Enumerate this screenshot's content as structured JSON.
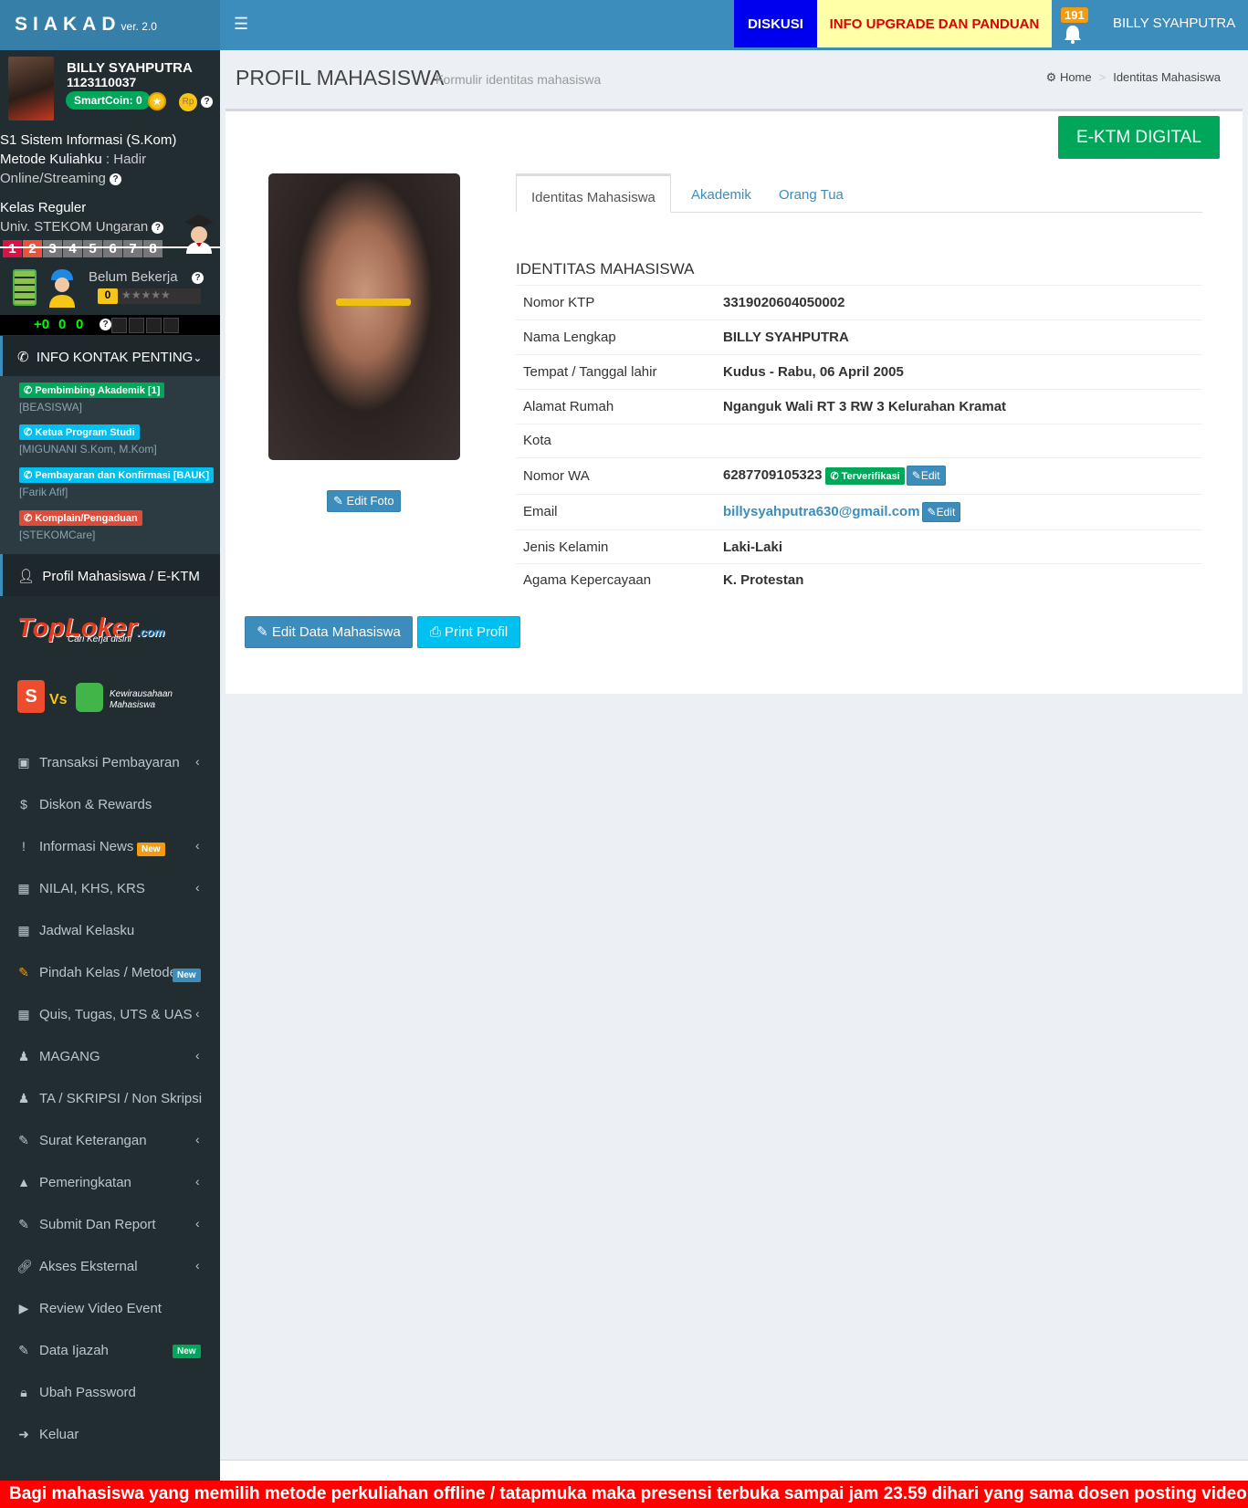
{
  "header": {
    "brand": "SIAKAD",
    "version": "ver. 2.0",
    "diskusi": "DISKUSI",
    "upgrade": "INFO UPGRADE DAN PANDUAN",
    "notif_count": "191",
    "user": "BILLY SYAHPUTRA"
  },
  "sidebar": {
    "name": "BILLY SYAHPUTRA",
    "nim": "1123110037",
    "smartcoin": "SmartCoin: 0",
    "prodi": "S1 Sistem Informasi (S.Kom)",
    "metode_label": "Metode Kuliahku",
    "metode_value": ": Hadir",
    "metode_line2": "Online/Streaming",
    "kelas": "Kelas Reguler",
    "kampus": "Univ. STEKOM Ungaran",
    "semesters": [
      "1",
      "2",
      "3",
      "4",
      "5",
      "6",
      "7",
      "8"
    ],
    "status": "Belum Bekerja",
    "stars": "★★★★★",
    "counter_plus": "+0",
    "counter_a": "0",
    "counter_b": "0",
    "info_kontak": "INFO KONTAK PENTING",
    "contacts": [
      {
        "label": "Pembimbing Akademik [1]",
        "sub": "[BEASISWA]"
      },
      {
        "label": "Ketua Program Studi",
        "sub": "[MIGUNANI S.Kom, M.Kom]"
      },
      {
        "label": "Pembayaran dan Konfirmasi [BAUK]",
        "sub": "[Farik Afif]"
      },
      {
        "label": "Komplain/Pengaduan",
        "sub": "[STEKOMCare]"
      }
    ],
    "profil_menu": "Profil Mahasiswa / E-KTM",
    "toploker": "TopLoker",
    "toploker_com": ".com",
    "toploker_sub": "Cari Kerja disini",
    "vs": "Vs",
    "kewirausahaan": "Kewirausahaan Mahasiswa",
    "menu": [
      {
        "label": "Transaksi Pembayaran"
      },
      {
        "label": "Diskon & Rewards"
      },
      {
        "label": "Informasi News",
        "badge": "New"
      },
      {
        "label": "NILAI, KHS, KRS"
      },
      {
        "label": "Jadwal Kelasku"
      },
      {
        "label": "Pindah Kelas / Metode",
        "badge": "New"
      },
      {
        "label": "Quis, Tugas, UTS & UAS"
      },
      {
        "label": "MAGANG"
      },
      {
        "label": "TA / SKRIPSI / Non Skripsi"
      },
      {
        "label": "Surat Keterangan"
      },
      {
        "label": "Pemeringkatan"
      },
      {
        "label": "Submit Dan Report"
      },
      {
        "label": "Akses Eksternal"
      },
      {
        "label": "Review Video Event"
      },
      {
        "label": "Data Ijazah",
        "badge": "New"
      },
      {
        "label": "Ubah Password"
      },
      {
        "label": "Keluar"
      }
    ]
  },
  "page": {
    "title": "PROFIL MAHASISWA",
    "subtitle": "Formulir identitas mahasiswa",
    "breadcrumb_home": "Home",
    "breadcrumb_current": "Identitas Mahasiswa",
    "ektm_button": "E-KTM DIGITAL",
    "edit_foto": "Edit Foto",
    "tabs": [
      "Identitas Mahasiswa",
      "Akademik",
      "Orang Tua"
    ],
    "section_title": "IDENTITAS MAHASISWA",
    "fields": [
      {
        "label": "Nomor KTP",
        "value": "3319020604050002"
      },
      {
        "label": "Nama Lengkap",
        "value": "BILLY SYAHPUTRA"
      },
      {
        "label": "Tempat / Tanggal lahir",
        "value": "Kudus - Rabu, 06 April 2005"
      },
      {
        "label": "Alamat Rumah",
        "value": "Nganguk Wali RT 3 RW 3 Kelurahan Kramat"
      },
      {
        "label": "Kota",
        "value": ""
      },
      {
        "label": "Nomor WA",
        "value": "6287709105323"
      },
      {
        "label": "Email",
        "value": "billysyahputra630@gmail.com"
      },
      {
        "label": "Jenis Kelamin",
        "value": "Laki-Laki"
      },
      {
        "label": "Agama Kepercayaan",
        "value": "K. Protestan"
      }
    ],
    "verified": "Terverifikasi",
    "edit_small": "Edit",
    "edit_data": "Edit Data Mahasiswa",
    "print": "Print Profil"
  },
  "marquee": "Bagi mahasiswa yang memilih metode perkuliahan offline / tatapmuka maka presensi terbuka sampai jam 23.59 dihari yang sama dosen posting video m"
}
